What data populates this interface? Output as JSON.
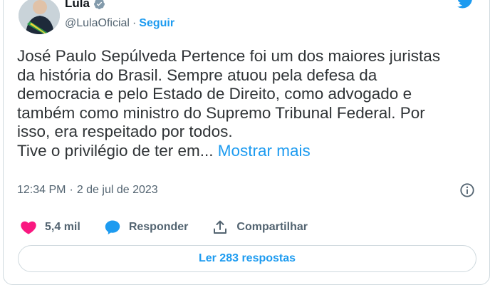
{
  "author": {
    "name": "Lula",
    "handle": "@LulaOficial",
    "separator": "·",
    "follow_label": "Seguir"
  },
  "tweet": {
    "text": "José Paulo Sepúlveda Pertence foi um dos maiores juristas\nda história do Brasil. Sempre atuou pela defesa da\ndemocracia e pelo Estado de Direito, como advogado e\ntambém como ministro do Supremo Tribunal Federal. Por\nisso, era respeitado por todos.\nTive o privilégio de ter em... ",
    "show_more": "Mostrar mais",
    "time": "12:34 PM",
    "date_separator": "·",
    "date": "2 de jul de 2023"
  },
  "actions": {
    "likes": "5,4 mil",
    "reply_label": "Responder",
    "share_label": "Compartilhar"
  },
  "replies_button": "Ler 283 respostas",
  "colors": {
    "accent": "#1d9bf0",
    "like": "#f91880",
    "muted": "#536471",
    "border": "#cfd9de"
  },
  "icons": [
    "verified-badge-icon",
    "twitter-bird-icon",
    "info-icon",
    "heart-icon",
    "reply-bubble-icon",
    "share-icon"
  ]
}
